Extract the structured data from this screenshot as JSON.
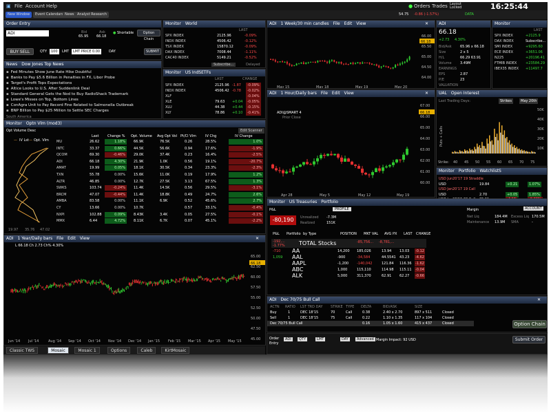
{
  "menu": {
    "file": "File",
    "account": "Account",
    "help": "Help",
    "orders": "Orders",
    "trades": "Trades",
    "layout": "Layout Locked",
    "time": "16:25:44",
    "price": "54.75",
    "chg": "-0.86 (-1.57%)",
    "data": "DATA"
  },
  "toolbar": {
    "new_window": "New Window",
    "event_cal": "Event Calendars",
    "news": "News",
    "analyst": "Analyst Research"
  },
  "order_entry": {
    "title": "Order Entry",
    "symbol": "ADI",
    "bid": "Bid",
    "bid_val": "65.95",
    "ask": "Ask",
    "ask_val": "66.18",
    "shortable": "Shortable",
    "option_chain": "Option Chain",
    "buy": "BUY",
    "sell": "SELL",
    "qty": "QTY",
    "qty_val": "100",
    "lmt": "LMT",
    "lmt_price": "LMT PRICE 0.00",
    "day": "DAY",
    "submit": "SUBMIT"
  },
  "world": {
    "tab1": "Monitor",
    "tab2": "World",
    "hdr": "LAST",
    "rows": [
      {
        "s": "SPX INDEX",
        "v": "2125.96",
        "c": "-0.09%"
      },
      {
        "s": "INDX INDEX",
        "v": "4506.42",
        "c": "-0.12%"
      },
      {
        "s": "TSX INDEX",
        "v": "15870.12",
        "c": "-0.09%"
      },
      {
        "s": "DAX INDEX",
        "v": "7008.44",
        "c": "-1.11%"
      },
      {
        "s": "CAC40 INDEX",
        "v": "5149.21",
        "c": "-0.52%"
      }
    ],
    "sub": "Subscribe...",
    "del": "Delayed"
  },
  "news": {
    "title": "News",
    "tab": "Dow Jones Top News",
    "items": [
      "Fed Minutes Show June Rate Hike Doubtful",
      "Banks to Pay $5.6 Billion in Penalties in FX, Libor Probe",
      "Target's Profit Tops Expectations",
      "Altice Looks to U.S. After Suddenlink Deal",
      "Standard General Gets the Nod to Buy RadioShack Trademark",
      "Lowe's Misses on Top, Bottom Lines",
      "ConAgra Unit to Pay Record Fine Related to Salmonella Outbreak",
      "BNP Billion to Pay $25 Million to Settle SEC Charges"
    ],
    "footer": "South America"
  },
  "idx": {
    "tab1": "Monitor",
    "tab2": "US IndSETFs",
    "h_last": "LAST",
    "h_chg": "CHANGE",
    "rows": [
      {
        "s": "SPX INDEX",
        "v": "2125.96",
        "c": "-1.87",
        "p": "-0.09%"
      },
      {
        "s": "INDX INDEX",
        "v": "4506.42",
        "c": "-0.78",
        "p": "-0.02%"
      },
      {
        "s": "XLF",
        "v": "",
        "c": "",
        "p": "-0.04%"
      },
      {
        "s": "XLE",
        "v": "79.63",
        "c": "+0.04",
        "p": "-0.05%"
      },
      {
        "s": "XLU",
        "v": "44.38",
        "c": "+0.44",
        "p": "-0.15%"
      },
      {
        "s": "XLY",
        "v": "78.86",
        "c": "+0.10",
        "p": "-0.41%"
      }
    ]
  },
  "optv": {
    "tab1": "Monitor",
    "tab2": "Optn Vlm (mod3)",
    "sub": "Opt Volume Desc",
    "edit": "Edit Scanner",
    "iv_lst": "IV Lst",
    "opt_vlm": "Opt. Vlm",
    "cols": [
      "Last",
      "Change %",
      "Opt. Volume",
      "Avg Opt Vol",
      "Pt/Cl Vlm",
      "IV Chg",
      "IV Change"
    ],
    "rows": [
      {
        "s": "MU",
        "l": "26.62",
        "c": "1.18%",
        "v": "66.9K",
        "a": "76.5K",
        "pc": "0.26",
        "ivc": "28.5%",
        "iv": "1.0%"
      },
      {
        "s": "INTC",
        "l": "33.37",
        "c": "0.66%",
        "v": "44.5K",
        "a": "56.6K",
        "pc": "0.94",
        "ivc": "17.6%",
        "iv": "-1.9%"
      },
      {
        "s": "QCOM",
        "l": "69.30",
        "c": "-0.46%",
        "v": "29.0K",
        "a": "37.4K",
        "pc": "0.23",
        "ivc": "16.4%",
        "iv": "-2.5%"
      },
      {
        "s": "ADI",
        "l": "66.18",
        "c": "4.30%",
        "v": "21.9K",
        "a": "1.0K",
        "pc": "0.56",
        "ivc": "19.1%",
        "iv": "-20.7%"
      },
      {
        "s": "AMAT",
        "l": "19.99",
        "c": "0.05%",
        "v": "18.1K",
        "a": "30.5K",
        "pc": "0.34",
        "ivc": "23.3%",
        "iv": "-2.3%"
      },
      {
        "s": "TXN",
        "l": "55.78",
        "c": "0.00%",
        "v": "15.6K",
        "a": "11.0K",
        "pc": "0.19",
        "ivc": "17.9%",
        "iv": "1.2%"
      },
      {
        "s": "ALTR",
        "l": "46.85",
        "c": "0.00%",
        "v": "12.7K",
        "a": "27.5K",
        "pc": "3.13",
        "ivc": "67.5%",
        "iv": "1.3%"
      },
      {
        "s": "SWKS",
        "l": "103.74",
        "c": "-0.24%",
        "v": "11.4K",
        "a": "14.5K",
        "pc": "0.56",
        "ivc": "29.5%",
        "iv": "-3.1%"
      },
      {
        "s": "BRCM",
        "l": "47.07",
        "c": "-0.44%",
        "v": "11.4K",
        "a": "18.8K",
        "pc": "0.49",
        "ivc": "24.7%",
        "iv": "2.6%"
      },
      {
        "s": "AMBA",
        "l": "83.58",
        "c": "0.00%",
        "v": "11.1K",
        "a": "6.9K",
        "pc": "0.52",
        "ivc": "45.6%",
        "iv": "2.7%"
      },
      {
        "s": "CY",
        "l": "13.66",
        "c": "0.00%",
        "v": "10.7K",
        "a": "",
        "pc": "0.57",
        "ivc": "33.1%",
        "iv": "-0.4%"
      },
      {
        "s": "NXPI",
        "l": "102.88",
        "c": "0.09%",
        "v": "8.43K",
        "a": "3.4K",
        "pc": "0.05",
        "ivc": "27.5%",
        "iv": "-0.1%"
      },
      {
        "s": "MMX",
        "l": "6.44",
        "c": "4.72%",
        "v": "8.11K",
        "a": "6.7K",
        "pc": "0.07",
        "ivc": "45.1%",
        "iv": "-2.2%"
      }
    ],
    "foot": [
      "19.97",
      "35.76",
      "47.02"
    ]
  },
  "week": {
    "sym": "ADI",
    "title": "1 Week/30 min candles",
    "file": "File",
    "edit": "Edit",
    "view": "View",
    "dates": [
      "May 15",
      "May 18",
      "May 19",
      "May 20"
    ],
    "yt": [
      "66.00",
      "65.50",
      "65.00",
      "64.50",
      "64.00"
    ],
    "tag": "66.18"
  },
  "ad": {
    "sym": "ADI",
    "price": "66.18",
    "chg": "+2.73",
    "pct": "4.30%",
    "bid_ask": "Bid/Ask",
    "ba": "65.96 x 66.18",
    "size": "Size",
    "sz": "2 x 5",
    "hl": "H/L",
    "hl_v": "66.29 63.91",
    "vol": "Volume",
    "vol_v": "3.49M",
    "earn": "EARNINGS",
    "eps": "EPS",
    "eps_v": "2.87",
    "pe": "P/E",
    "pe_v": "23",
    "val": "VALUATION"
  },
  "rmon": {
    "tab": "Monitor",
    "hdr": "LAST",
    "rows": [
      {
        "s": "SPX INDEX",
        "v": "+2125.9"
      },
      {
        "s": "DAX INDEX",
        "v": "Subscribe..."
      },
      {
        "s": "SMI INDEX",
        "v": "+9295.60"
      },
      {
        "s": "ECE INDEX",
        "v": "+3651.06"
      },
      {
        "s": "N225",
        "v": "+20196.41"
      },
      {
        "s": "FTMIB INDEX",
        "v": "+23584.29"
      },
      {
        "s": "IBEX35 INDEX",
        "v": "+11497.7"
      }
    ]
  },
  "hourly": {
    "sym": "ADI",
    "title": "1 Hour/Daily bars",
    "file": "File",
    "edit": "Edit",
    "view": "View",
    "legend": "ADI@SMART 4",
    "prior": "Prior Close",
    "dates": [
      "Apr 28",
      "May 5",
      "May 12",
      "May 19"
    ],
    "yt": [
      "67.00",
      "66.00",
      "65.00",
      "64.00",
      "63.00",
      "62.00",
      "61.00",
      "60.00"
    ],
    "tag": "66.18"
  },
  "oi": {
    "sym": "UAL",
    "title": "Open Interest",
    "last_days": "Last Trading Days:",
    "strikes": "Strikes",
    "date": "May 20th",
    "ylab": "Puts + Calls",
    "xlab": "Strike:",
    "xt": [
      "40",
      "45",
      "50",
      "55",
      "60",
      "65",
      "70",
      "75"
    ],
    "yt": [
      "50K",
      "40K",
      "30K",
      "20K",
      "10K"
    ]
  },
  "port": {
    "tab1": "Monitor",
    "tab2": "Portfolio",
    "tab3": "WatchlistS",
    "rows": [
      {
        "s": "USD Jun20'17 19 Straddle",
        "l": "",
        "c": "",
        "p": ""
      },
      {
        "s": "USD",
        "l": "19.84",
        "c": "+0.21",
        "p": "1.07%"
      },
      {
        "s": "USD Jan20'17 19 Call",
        "l": "",
        "c": "",
        "p": ""
      },
      {
        "s": "USD",
        "l": "2.70",
        "c": "+0.05",
        "p": "1.85%"
      },
      {
        "s": "USO Jun26'15 20 Call",
        "l": "35.51",
        "c": "-4.12",
        "p": "-0.66%"
      },
      {
        "s": "GC Jun26'15 @1299",
        "l": "1209.20",
        "c": "+2.50",
        "p": "0.21%"
      },
      {
        "s": "GKS",
        "l": "53.26",
        "c": "-0.08",
        "p": "-0.14%"
      },
      {
        "s": "ADI Dec18'15 67.50 Call",
        "l": "",
        "c": "",
        "p": ""
      }
    ]
  },
  "daily": {
    "sym": "ADI",
    "title": "1 Year/Daily bars",
    "file": "File",
    "edit": "Edit",
    "view": "View",
    "legend": "L 66.18 Ch 2.73 Ch% 4.30%",
    "dates": [
      "Jun '14",
      "Jul '14",
      "Aug '14",
      "Sep '14",
      "Oct '14",
      "Nov '14",
      "Dec '14",
      "Jan '15",
      "Feb '15",
      "Mar '15",
      "Apr '15",
      "May '15"
    ],
    "yt": [
      "65.00",
      "62.50",
      "60.00",
      "57.50",
      "55.00",
      "52.50",
      "50.00",
      "47.50",
      "45.00"
    ],
    "tag": "66.18"
  },
  "acct": {
    "tab1": "Monitor",
    "tab2": "US Treasuries",
    "tab3": "Portfolio",
    "pnl": "P&L",
    "profile": "PROFILE",
    "pnl_val": "-80,190",
    "unreal": "Unrealized",
    "unreal_v": "-7.3M",
    "real": "Realized",
    "real_v": "151K",
    "margin": "Margin",
    "account": "ACCOUNT",
    "net_liq": "Net Liq",
    "net_liq_v": "184.4M",
    "excess": "Excess Liq",
    "excess_v": "170.5M",
    "maint": "Maintenance",
    "maint_v": "13.9M",
    "sma": "SMA",
    "sma_v": "-",
    "cols": [
      "P&L",
      "Portfolio",
      "by Type",
      "POSITION",
      "MKT VAL",
      "AVG PX",
      "LAST",
      "CHANGE"
    ],
    "total": {
      "a": "-192,...",
      "b": "-1.77%",
      "name": "TOTAL Stocks",
      "mv": "-85,756...",
      "mv2": "-8,781,...",
      "rows": []
    },
    "rows": [
      {
        "p": "-710",
        "n": "AA",
        "pos": "14,200",
        "mv": "185,026",
        "avg": "13.94",
        "last": "13.03",
        "chg": "-0.12"
      },
      {
        "p": "1,059",
        "n": "AAL",
        "pos": "-900",
        "mv": "-34,584",
        "avg": "44.5541",
        "last": "43.23",
        "chg": "-4.62"
      },
      {
        "p": "",
        "n": "AAPL",
        "pos": "-1,200",
        "mv": "-140,042",
        "avg": "121.84",
        "last": "116.36",
        "chg": "-1.62"
      },
      {
        "p": "",
        "n": "ABC",
        "pos": "1,000",
        "mv": "115,110",
        "avg": "114.98",
        "last": "115.11",
        "chg": "-0.04"
      },
      {
        "p": "",
        "n": "ALK",
        "pos": "5,000",
        "mv": "311,370",
        "avg": "62.91",
        "last": "62.27",
        "chg": "-0.66"
      }
    ]
  },
  "spread": {
    "sym": "ADI",
    "title": "Dec 70/75 Bull Call",
    "cols": [
      "ACTN",
      "RATIO",
      "LST TRD DAY",
      "STRIKE",
      "TYPE",
      "DELTA",
      "BID/ASK",
      "SIZE"
    ],
    "rows": [
      {
        "a": "Buy",
        "r": "1",
        "d": "DEC 18'15",
        "k": "70",
        "t": "Call",
        "dl": "0.38",
        "ba": "2.40 x 2.70",
        "sz": "897 x 511",
        "st": "Closed"
      },
      {
        "a": "Sell",
        "r": "1",
        "d": "DEC 18'15",
        "k": "75",
        "t": "Call",
        "dl": "0.22",
        "ba": "1.10 x 1.35",
        "sz": "117 x 104",
        "st": "Closed"
      },
      {
        "a": "Dec 70/75 Bull Call",
        "r": "",
        "d": "",
        "k": "",
        "t": "",
        "dl": "0.16",
        "ba": "1.05 x 1.60",
        "sz": "415 x 437",
        "st": "Closed"
      }
    ],
    "option_chain": "Option Chain"
  },
  "bottom_order": {
    "label": "Order Entry",
    "sym": "ADI",
    "qty": "QTY",
    "lmt": "LMT",
    "day": "DAY",
    "adv": "Advanced",
    "margin": "Margin Impact: 92 USD",
    "submit": "Submit Order"
  },
  "tabs": [
    "Classic TWS",
    "Mosaic",
    "Mosaic 1",
    "Options",
    "Caleb",
    "KirtMosaic"
  ]
}
